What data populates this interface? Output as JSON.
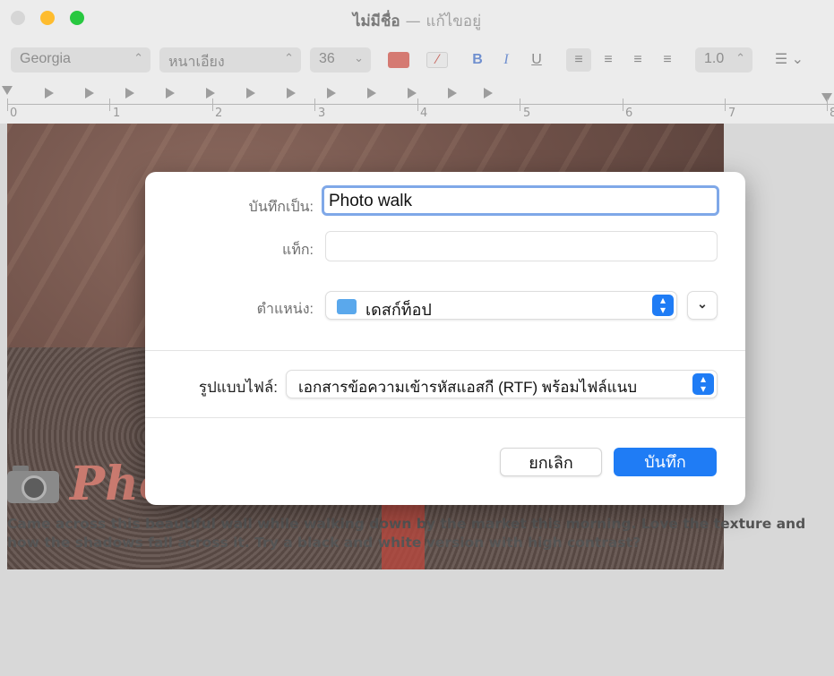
{
  "window": {
    "title": "ไม่มีชื่อ",
    "title_separator": "—",
    "title_status": "แก้ไขอยู่",
    "traffic_lights": {
      "close": "#ff5f57",
      "minimize": "#febc2e",
      "zoom": "#28c840"
    }
  },
  "toolbar": {
    "font_family": "Georgia",
    "font_style": "หนาเอียง",
    "font_size": "36",
    "text_color": "#e07a6f",
    "bold_label": "B",
    "italic_label": "I",
    "underline_label": "U",
    "line_spacing": "1.0",
    "icons": [
      "text-color-swatch",
      "highlight-color-icon",
      "bold-icon",
      "italic-icon",
      "underline-icon",
      "align-left-icon",
      "align-center-icon",
      "align-right-icon",
      "justify-icon",
      "list-icon"
    ]
  },
  "ruler": {
    "numbers": [
      "0",
      "1",
      "2",
      "3",
      "4",
      "5",
      "6",
      "7",
      "8"
    ]
  },
  "document": {
    "heading": "Photo walk",
    "body": "Came across this beautiful wall while walking down by the market this morning. Love the texture and how the shadows fall across it. Try a black and white version with high contrast?"
  },
  "save_sheet": {
    "save_as_label": "บันทึกเป็น:",
    "save_as_value": "Photo walk",
    "tags_label": "แท็ก:",
    "tags_value": "",
    "location_label": "ตำแหน่ง:",
    "location_value": "เดสก์ท็อป",
    "format_label": "รูปแบบไฟล์:",
    "format_value": "เอกสารข้อความเข้ารหัสแอสกี (RTF) พร้อมไฟล์แนบ",
    "cancel_label": "ยกเลิก",
    "save_label": "บันทึก",
    "accent": "#1f7cf5"
  }
}
